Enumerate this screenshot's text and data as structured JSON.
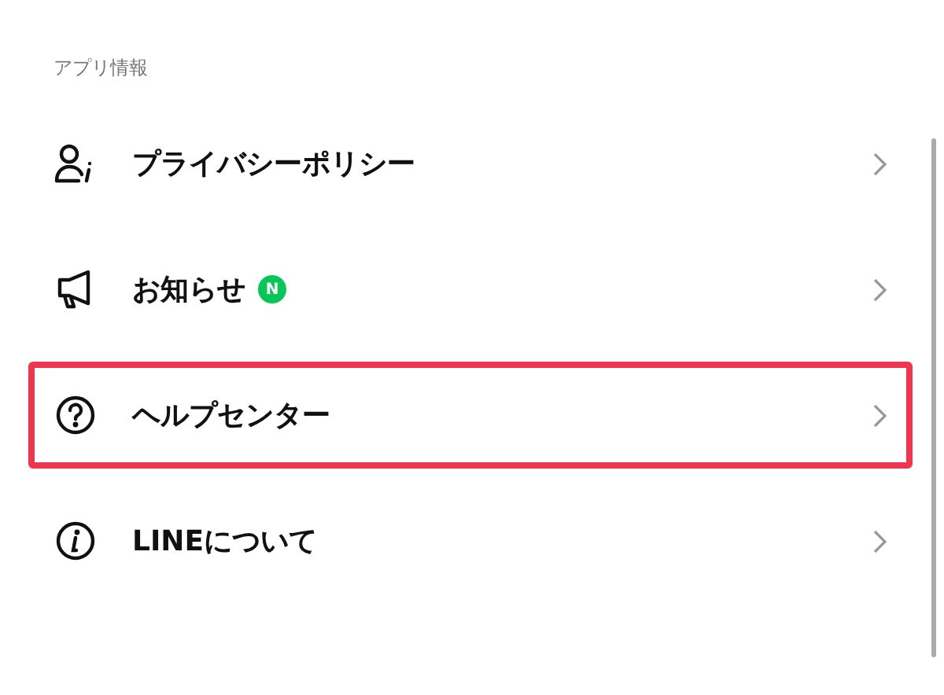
{
  "section": {
    "title": "アプリ情報"
  },
  "items": [
    {
      "label": "プライバシーポリシー",
      "highlighted": false
    },
    {
      "label": "お知らせ",
      "badge": "N",
      "highlighted": false
    },
    {
      "label": "ヘルプセンター",
      "highlighted": true
    },
    {
      "label": "LINEについて",
      "highlighted": false
    }
  ]
}
